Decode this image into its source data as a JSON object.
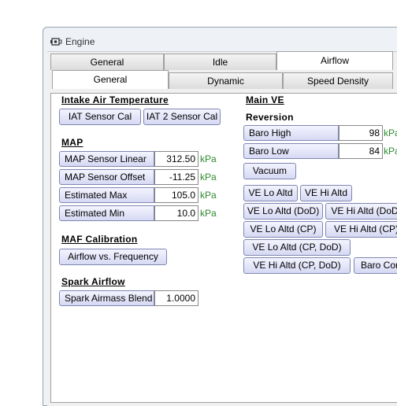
{
  "window": {
    "title": "Engine"
  },
  "top_tabs": [
    "General",
    "Idle",
    "Airflow"
  ],
  "sub_tabs": [
    "General",
    "Dynamic",
    "Speed Density"
  ],
  "iat": {
    "header": "Intake Air Temperature",
    "sensor_cal": "IAT Sensor Cal",
    "sensor2_cal": "IAT 2 Sensor Cal"
  },
  "map": {
    "header": "MAP",
    "rows": [
      {
        "label": "MAP Sensor Linear",
        "value": "312.50",
        "unit": "kPa"
      },
      {
        "label": "MAP Sensor Offset",
        "value": "-11.25",
        "unit": "kPa"
      },
      {
        "label": "Estimated Max",
        "value": "105.0",
        "unit": "kPa"
      },
      {
        "label": "Estimated Min",
        "value": "10.0",
        "unit": "kPa"
      }
    ]
  },
  "maf": {
    "header": "MAF Calibration",
    "button": "Airflow vs. Frequency"
  },
  "spark": {
    "header": "Spark Airflow",
    "label": "Spark Airmass Blend",
    "value": "1.0000"
  },
  "main_ve": {
    "header": "Main VE",
    "reversion": "Reversion",
    "baro_high": {
      "label": "Baro High",
      "value": "98",
      "unit": "kPa"
    },
    "baro_low": {
      "label": "Baro Low",
      "value": "84",
      "unit": "kPa"
    },
    "vacuum": "Vacuum",
    "ve_lo_altd": "VE Lo Altd",
    "ve_hi_altd": "VE Hi Altd",
    "ve_lo_altd_dod": "VE Lo Altd (DoD)",
    "ve_hi_altd_dod": "VE Hi Altd (DoD)",
    "ve_lo_altd_cp": "VE Lo Altd (CP)",
    "ve_hi_altd_cp": "VE Hi Altd (CP)",
    "ve_lo_altd_cp_dod": "VE Lo Altd (CP, DoD)",
    "ve_hi_altd_cp_dod": "VE Hi Altd (CP, DoD)",
    "baro_corr": "Baro Corr"
  }
}
